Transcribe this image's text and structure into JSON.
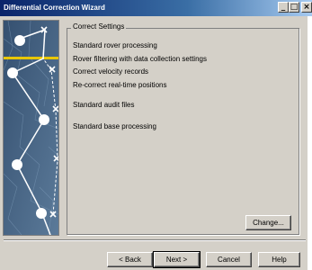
{
  "window": {
    "title": "Differential Correction Wizard",
    "title_buttons": {
      "minimize": "_",
      "maximize": "□",
      "close": "×"
    }
  },
  "group": {
    "legend": "Correct Settings",
    "items": [
      "Standard rover processing",
      "Rover filtering with data collection settings",
      "Correct velocity records",
      "Re-correct real-time positions",
      "Standard audit files",
      "Standard base processing"
    ],
    "change_label": "Change..."
  },
  "nav": {
    "back_label": "< Back",
    "next_label": "Next  >",
    "cancel_label": "Cancel",
    "help_label": "Help"
  },
  "colors": {
    "titlebar_start": "#0a246a",
    "titlebar_end": "#a6caf0",
    "dialog_face": "#d4d0c8",
    "image_background": "#44607e",
    "route_accent": "#e8c600"
  }
}
